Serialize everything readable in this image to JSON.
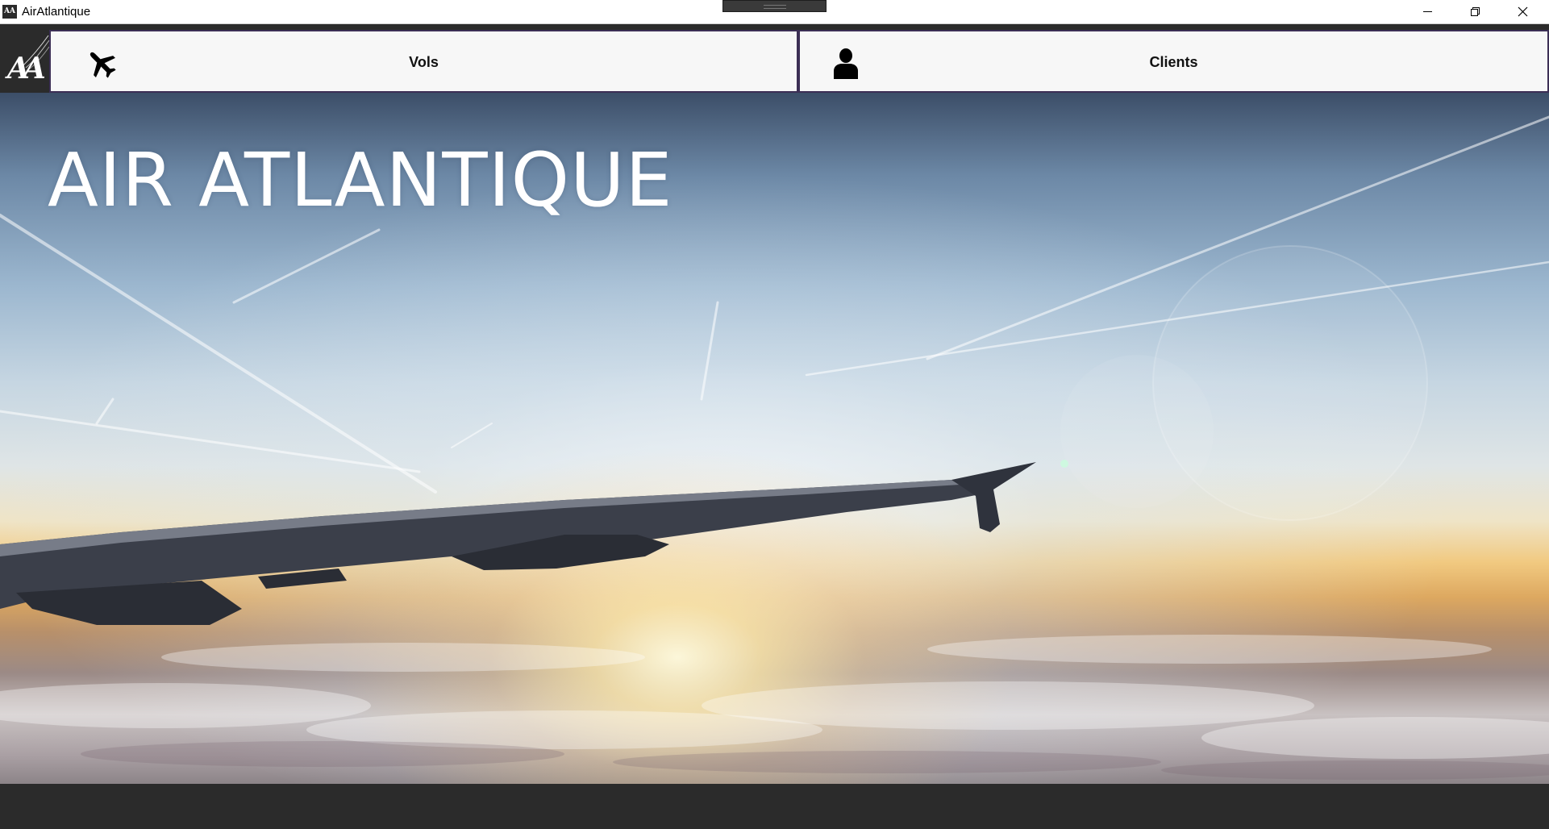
{
  "window": {
    "title": "AirAtlantique",
    "icon_name": "app-logo-icon",
    "icon_text": "AA",
    "controls": [
      "minimize-icon",
      "restore-icon",
      "close-icon"
    ]
  },
  "sidebar": {
    "logo_text": "AA"
  },
  "nav": {
    "items": [
      {
        "label": "Vols",
        "icon": "airplane-icon"
      },
      {
        "label": "Clients",
        "icon": "user-icon"
      }
    ],
    "border_color": "#3c2f55",
    "background": "#f7f7f7"
  },
  "hero": {
    "title": "AIR ATLANTIQUE"
  },
  "colors": {
    "app_background": "#2b2b2b",
    "title_text": "#ffffff"
  }
}
